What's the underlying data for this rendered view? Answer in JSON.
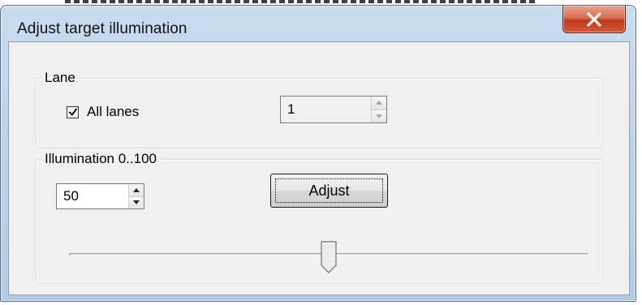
{
  "window": {
    "title": "Adjust target illumination"
  },
  "icons": {
    "close": "close-x-icon",
    "spin_up": "spin-up-icon",
    "spin_down": "spin-down-icon",
    "check": "check-icon"
  },
  "colors": {
    "close_button": "#c7402a",
    "title_bar": "#bcd3ea",
    "client": "#f0f0f0"
  },
  "lane": {
    "legend": "Lane",
    "all_lanes_label": "All lanes",
    "all_lanes_checked": true,
    "lane_value": "1"
  },
  "illumination": {
    "legend": "Illumination 0..100",
    "value": "50",
    "adjust_label": "Adjust",
    "slider_level_percent": 50
  }
}
